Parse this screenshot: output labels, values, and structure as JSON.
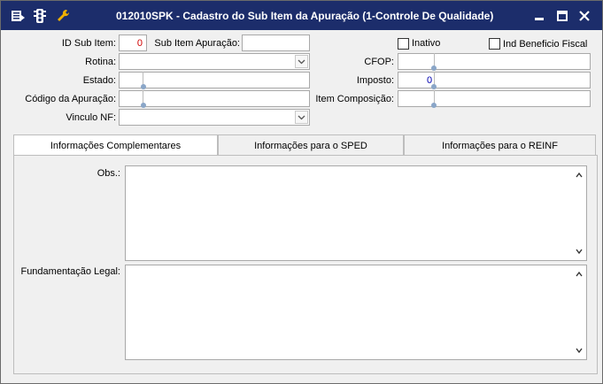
{
  "window": {
    "title": "012010SPK - Cadastro do Sub Item da Apuração (1-Controle De Qualidade)",
    "title_bar_color": "#1c2d6b",
    "icons": [
      "menu-icon",
      "traffic-light-icon",
      "wrench-icon"
    ],
    "controls": [
      "minimize-icon",
      "maximize-icon",
      "close-icon"
    ]
  },
  "form": {
    "id_sub_item_label": "ID Sub Item:",
    "id_sub_item_value": "0",
    "sub_item_apuracao_label": "Sub Item Apuração:",
    "sub_item_apuracao_value": "",
    "inativo_label": "Inativo",
    "ind_beneficio_label": "Ind Beneficio Fiscal",
    "rotina_label": "Rotina:",
    "cfop_label": "CFOP:",
    "estado_label": "Estado:",
    "imposto_label": "Imposto:",
    "imposto_value": "0",
    "codigo_apuracao_label": "Código da Apuração:",
    "item_composicao_label": "Item Composição:",
    "vinculo_nf_label": "Vinculo NF:"
  },
  "tabs": [
    {
      "label": "Informações Complementares",
      "active": true
    },
    {
      "label": "Informações para o SPED",
      "active": false
    },
    {
      "label": "Informações para o REINF",
      "active": false
    }
  ],
  "panel": {
    "obs_label": "Obs.:",
    "fundamentacao_label": "Fundamentação Legal:"
  }
}
